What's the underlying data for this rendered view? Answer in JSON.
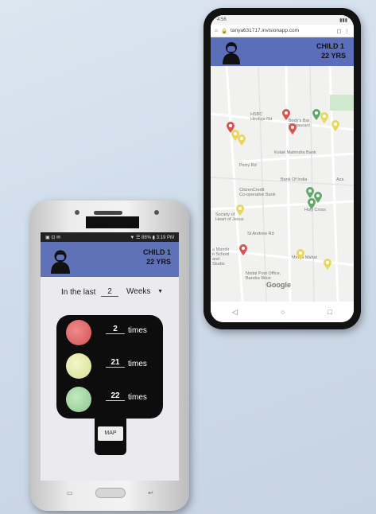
{
  "phone_b": {
    "status_time": "4:56",
    "url": "tanya631717.invisionapp.com",
    "header": {
      "name": "CHILD 1",
      "age": "22 YRS"
    },
    "map_labels": {
      "hsbc": "HSBC",
      "hsbc_sub": "Hinduja Rd",
      "bodys": "Body's Bar",
      "bodys_sub": "Restaurant",
      "kotak": "Kotak Mahindra Bank",
      "perry": "Perry Rd",
      "boi": "Bank Of India",
      "citizen": "CitizenCredit\nCo-operative Bank",
      "aza": "Aza",
      "society": "Society of\nHeart of Jesus",
      "holycross": "Holy Cross",
      "stand": "St Andrew Rd",
      "mandir": "a Mandir\nn School\nand\nStudio",
      "mahal": "Mehta Mahal",
      "post": "Nodal Post Office,\nBandra West",
      "google": "Google"
    },
    "colors": {
      "header": "#5b6eb9",
      "pin_red": "#d9534f",
      "pin_yellow": "#e8d95c",
      "pin_green": "#5fa86a"
    }
  },
  "phone_a": {
    "status_left": "▣ ⊡ ✉",
    "status_right": "▼ ☰ 88% ▮ 3:19 PM",
    "header": {
      "name": "CHILD 1",
      "age": "22 YRS"
    },
    "filter": {
      "prefix": "In the last",
      "number": "2",
      "unit": "Weeks"
    },
    "counts": [
      {
        "color": "red",
        "value": "2",
        "label": "times"
      },
      {
        "color": "yellow",
        "value": "21",
        "label": "times"
      },
      {
        "color": "green",
        "value": "22",
        "label": "times"
      }
    ],
    "map_button": "MAP",
    "colors": {
      "header": "#5f72b8"
    }
  }
}
